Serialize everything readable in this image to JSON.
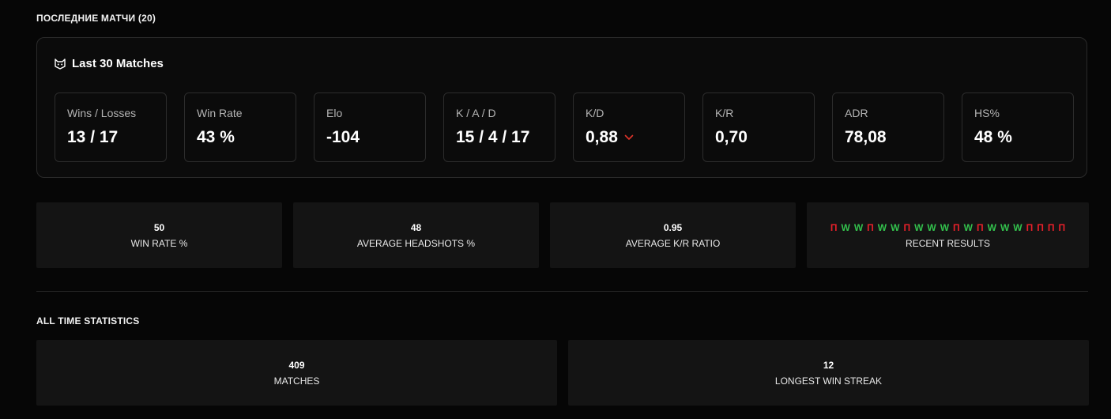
{
  "recent_section": {
    "title": "ПОСЛЕДНИЕ МАТЧИ (20)"
  },
  "last30": {
    "icon": "cat-head-icon",
    "title": "Last 30 Matches",
    "stats": [
      {
        "name": "Wins / Losses",
        "value": "13 / 17"
      },
      {
        "name": "Win Rate",
        "value": "43 %"
      },
      {
        "name": "Elo",
        "value": "-104"
      },
      {
        "name": "K / A / D",
        "value": "15 / 4 / 17"
      },
      {
        "name": "K/D",
        "value": "0,88",
        "trend_icon": "chevron-down-icon",
        "trend_color": "#e0332a"
      },
      {
        "name": "K/R",
        "value": "0,70"
      },
      {
        "name": "ADR",
        "value": "78,08"
      },
      {
        "name": "HS%",
        "value": "48 %"
      }
    ]
  },
  "summary": [
    {
      "value": "50",
      "caption": "WIN RATE %"
    },
    {
      "value": "48",
      "caption": "AVERAGE HEADSHOTS %"
    },
    {
      "value": "0.95",
      "caption": "AVERAGE K/R RATIO"
    }
  ],
  "recent_results": {
    "caption": "RECENT RESULTS",
    "results": [
      "П",
      "W",
      "W",
      "П",
      "W",
      "W",
      "П",
      "W",
      "W",
      "W",
      "П",
      "W",
      "П",
      "W",
      "W",
      "W",
      "П",
      "П",
      "П",
      "П"
    ],
    "colors": {
      "win": "#33c24d",
      "loss": "#e8202a"
    }
  },
  "alltime_section": {
    "title": "ALL TIME STATISTICS",
    "tiles": [
      {
        "value": "409",
        "caption": "MATCHES"
      },
      {
        "value": "12",
        "caption": "LONGEST WIN STREAK"
      }
    ]
  }
}
